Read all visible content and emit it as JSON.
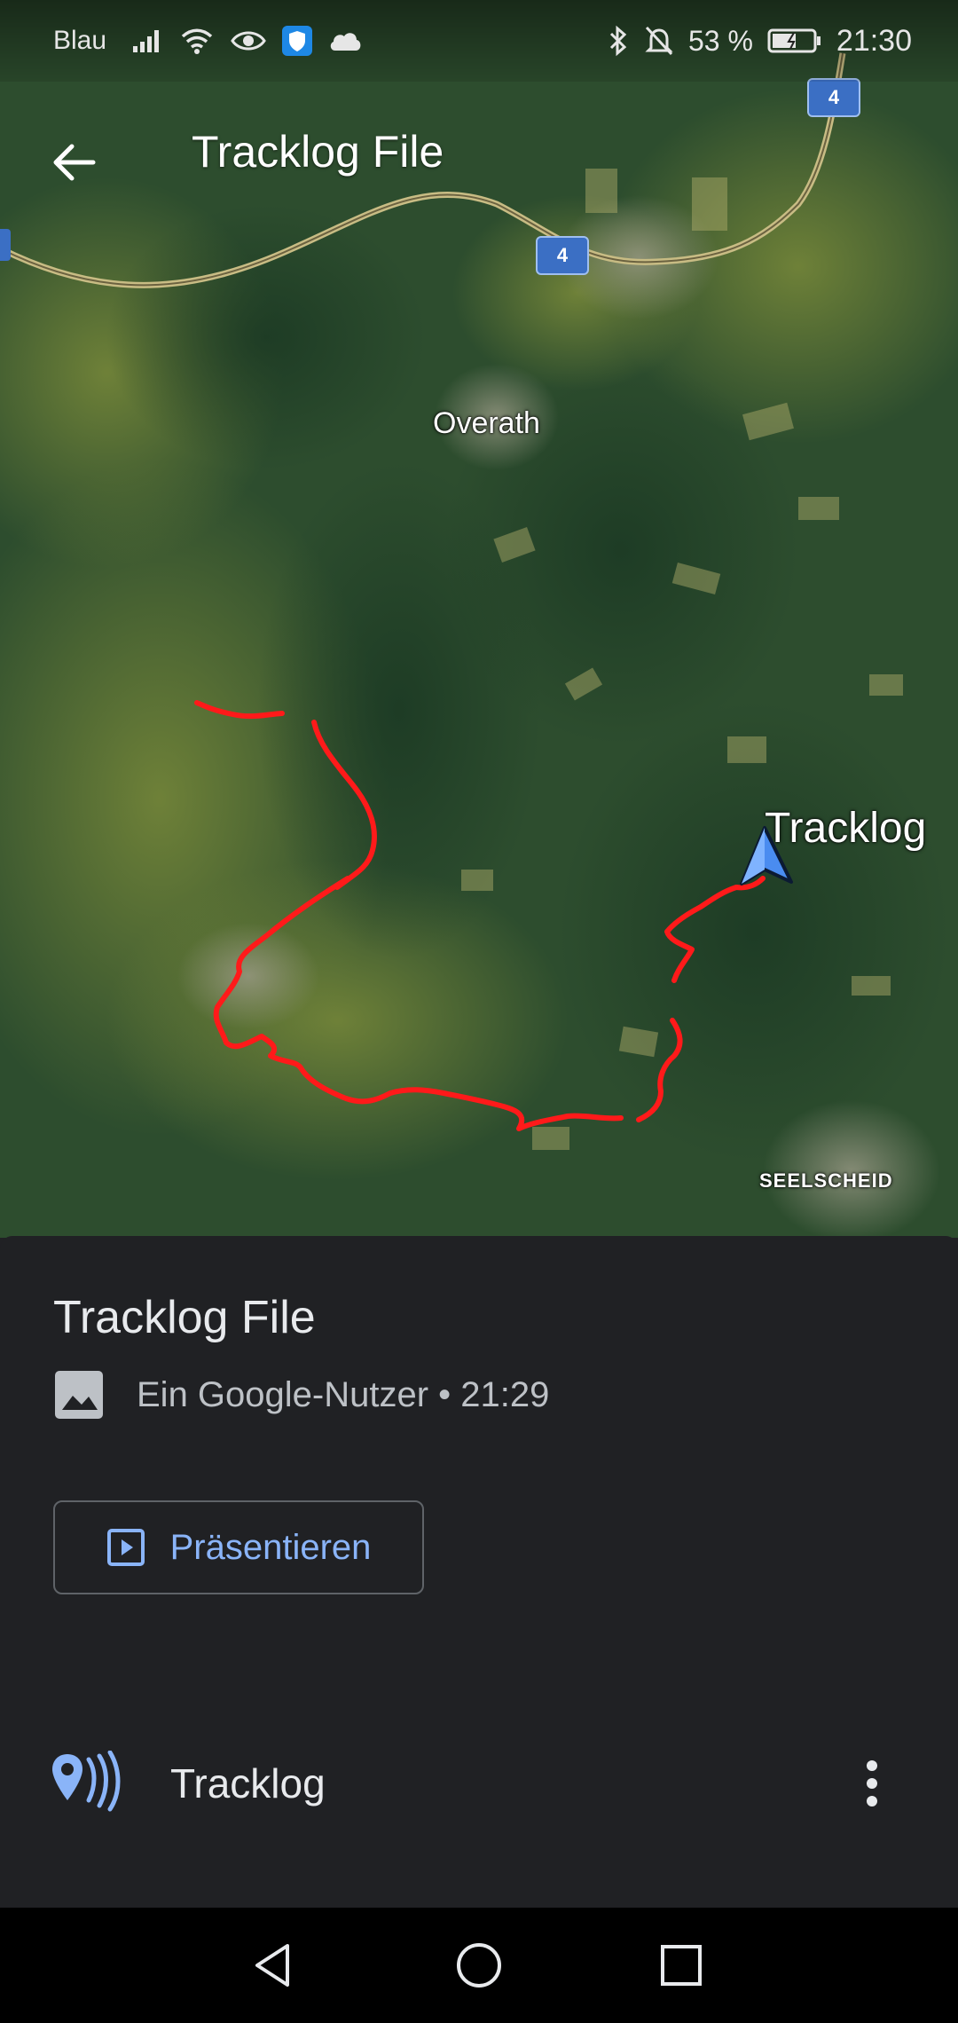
{
  "status_bar": {
    "carrier": "Blau",
    "battery": "53 %",
    "time": "21:30",
    "icons": [
      "signal-icon",
      "wifi-icon",
      "eye-icon",
      "shield-icon",
      "cloud-icon",
      "bluetooth-icon",
      "mute-icon",
      "battery-icon"
    ]
  },
  "app_bar": {
    "title": "Tracklog File",
    "back_icon": "back-arrow-icon"
  },
  "map": {
    "labels": {
      "town": "Overath",
      "region": "SEELSCHEID",
      "marker": "Tracklog"
    },
    "road_shields": [
      "4",
      "4"
    ],
    "track_color": "#ff1a1a",
    "marker_color": "#4a8cf0"
  },
  "sheet": {
    "title": "Tracklog File",
    "meta": "Ein Google-Nutzer • 21:29",
    "present_label": "Präsentieren",
    "layer_label": "Tracklog",
    "accent": "#8ab4f8"
  },
  "nav_bar": {
    "icons": [
      "back-triangle-icon",
      "home-circle-icon",
      "recents-square-icon"
    ]
  }
}
